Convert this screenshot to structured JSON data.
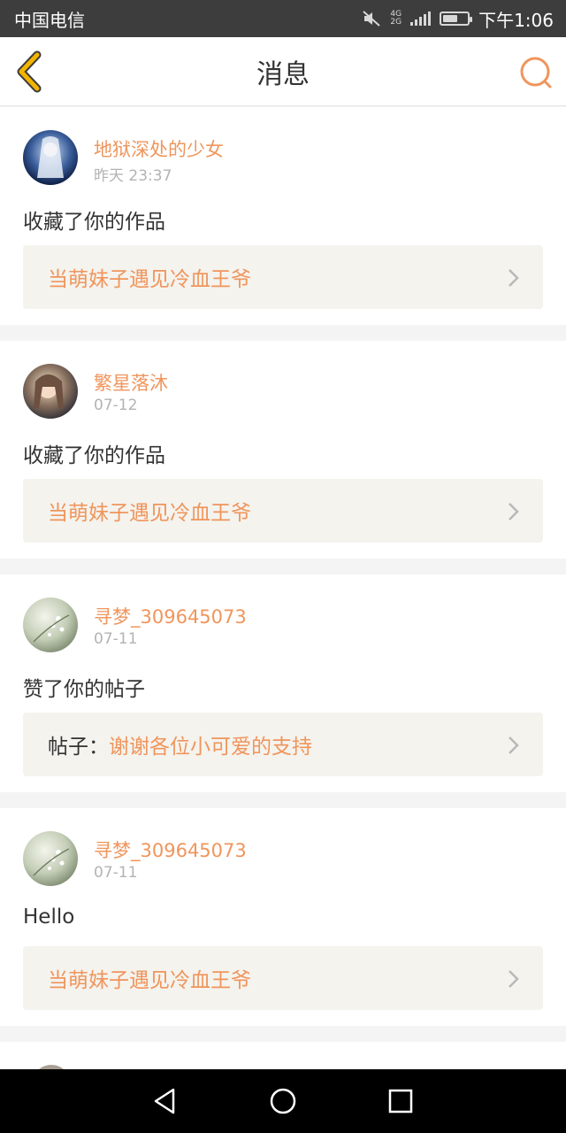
{
  "status_bar": {
    "carrier": "中国电信",
    "network_top": "4G",
    "network_bottom": "2G",
    "time": "下午1:06",
    "battery_level": 0.6,
    "icons": [
      "mute-icon",
      "signal-icon",
      "battery-icon"
    ]
  },
  "header": {
    "title": "消息",
    "back_icon": "chevron-left-icon",
    "search_icon": "search-icon"
  },
  "messages": [
    {
      "user": "地狱深处的少女",
      "time": "昨天 23:37",
      "text": "收藏了你的作品",
      "ref_prefix": "",
      "ref_title": "当萌妹子遇见冷血王爷",
      "avatar_style": "blue-anime"
    },
    {
      "user": "繁星落沐",
      "time": "07-12",
      "text": "收藏了你的作品",
      "ref_prefix": "",
      "ref_title": "当萌妹子遇见冷血王爷",
      "avatar_style": "warm-anime"
    },
    {
      "user": "寻梦_309645073",
      "time": "07-11",
      "text": "赞了你的帖子",
      "ref_prefix": "帖子：",
      "ref_title": "谢谢各位小可爱的支持",
      "avatar_style": "green-floral"
    },
    {
      "user": "寻梦_309645073",
      "time": "07-11",
      "text": "Hello",
      "ref_prefix": "",
      "ref_title": "当萌妹子遇见冷血王爷",
      "avatar_style": "green-floral"
    }
  ],
  "system_nav": {
    "icons": [
      "back-triangle-icon",
      "home-circle-icon",
      "recents-square-icon"
    ]
  },
  "colors": {
    "accent": "#f0955c",
    "back_arrow": "#f3b400",
    "status_bar_bg": "#3d3d3d",
    "ref_box_bg": "#f4f3ee",
    "page_bg": "#f4f4f4"
  }
}
